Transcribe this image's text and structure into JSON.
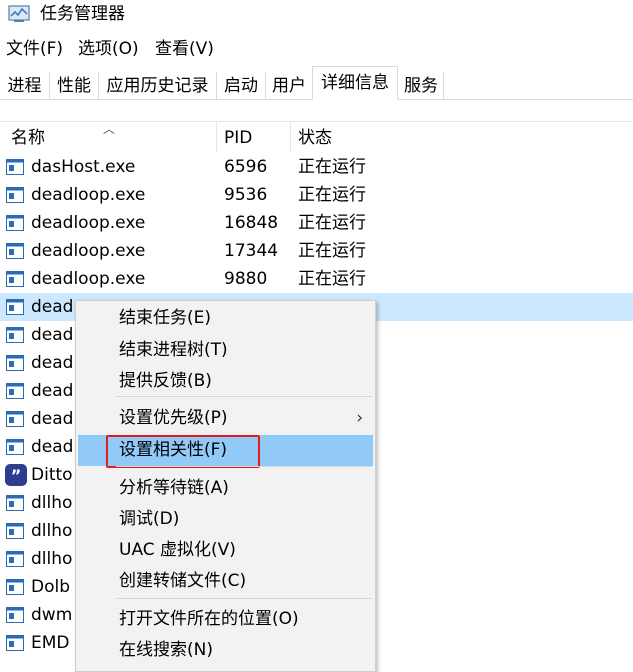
{
  "window": {
    "title": "任务管理器"
  },
  "menubar": {
    "items": [
      "文件(F)",
      "选项(O)",
      "查看(V)"
    ]
  },
  "tabs": [
    {
      "label": "进程",
      "active": false
    },
    {
      "label": "性能",
      "active": false
    },
    {
      "label": "应用历史记录",
      "active": false
    },
    {
      "label": "启动",
      "active": false
    },
    {
      "label": "用户",
      "active": false
    },
    {
      "label": "详细信息",
      "active": true
    },
    {
      "label": "服务",
      "active": false
    }
  ],
  "table": {
    "columns": {
      "name": "名称",
      "pid": "PID",
      "status": "状态"
    },
    "rows": [
      {
        "name": "dasHost.exe",
        "pid": "6596",
        "status": "正在运行",
        "icon": "window-icon"
      },
      {
        "name": "deadloop.exe",
        "pid": "9536",
        "status": "正在运行",
        "icon": "window-icon"
      },
      {
        "name": "deadloop.exe",
        "pid": "16848",
        "status": "正在运行",
        "icon": "window-icon"
      },
      {
        "name": "deadloop.exe",
        "pid": "17344",
        "status": "正在运行",
        "icon": "window-icon"
      },
      {
        "name": "deadloop.exe",
        "pid": "9880",
        "status": "正在运行",
        "icon": "window-icon"
      },
      {
        "name": "dead",
        "pid": "",
        "status": "",
        "icon": "window-icon",
        "selected": true
      },
      {
        "name": "dead",
        "pid": "",
        "status": "",
        "icon": "window-icon"
      },
      {
        "name": "dead",
        "pid": "",
        "status": "",
        "icon": "window-icon"
      },
      {
        "name": "dead",
        "pid": "",
        "status": "",
        "icon": "window-icon"
      },
      {
        "name": "dead",
        "pid": "",
        "status": "",
        "icon": "window-icon"
      },
      {
        "name": "dead",
        "pid": "",
        "status": "",
        "icon": "window-icon"
      },
      {
        "name": "Ditto",
        "pid": "",
        "status": "",
        "icon": "ditto-icon"
      },
      {
        "name": "dllho",
        "pid": "",
        "status": "",
        "icon": "window-icon"
      },
      {
        "name": "dllho",
        "pid": "",
        "status": "",
        "icon": "window-icon"
      },
      {
        "name": "dllho",
        "pid": "",
        "status": "",
        "icon": "window-icon"
      },
      {
        "name": "Dolb",
        "pid": "",
        "status": "",
        "icon": "window-icon"
      },
      {
        "name": "dwm",
        "pid": "",
        "status": "",
        "icon": "window-icon"
      },
      {
        "name": "EMD",
        "pid": "",
        "status": "",
        "icon": "window-icon"
      }
    ]
  },
  "context_menu": {
    "items": [
      {
        "label": "结束任务(E)"
      },
      {
        "label": "结束进程树(T)"
      },
      {
        "label": "提供反馈(B)"
      },
      {
        "label": "设置优先级(P)",
        "submenu": true
      },
      {
        "label": "设置相关性(F)",
        "hover": true,
        "highlighted": true
      },
      {
        "label": "分析等待链(A)"
      },
      {
        "label": "调试(D)"
      },
      {
        "label": "UAC 虚拟化(V)"
      },
      {
        "label": "创建转储文件(C)"
      },
      {
        "label": "打开文件所在的位置(O)"
      },
      {
        "label": "在线搜索(N)"
      }
    ],
    "submenu_arrow": "›"
  },
  "colors": {
    "selected_row": "#cce8ff",
    "menu_hover": "#91c9f7",
    "highlight_box": "#e11d1d"
  }
}
